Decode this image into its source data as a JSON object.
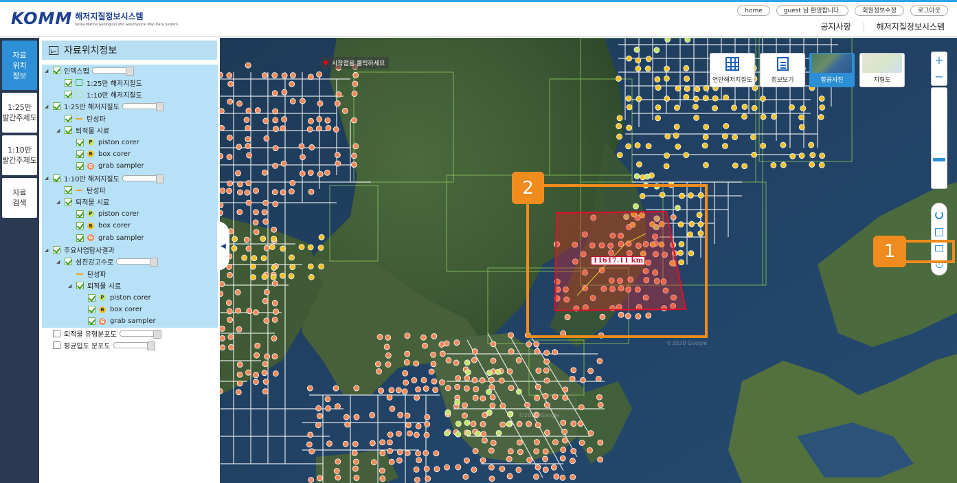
{
  "header": {
    "logo_mark": "KOMM",
    "logo_ko": "해저지질정보시스템",
    "logo_en": "Korea Marine Geological and Geophysical Map Data System",
    "links": [
      "home",
      "guest 님 환영합니다.",
      "회원정보수정",
      "로그아웃"
    ],
    "nav": [
      "공지사항",
      "해저지질정보시스템"
    ]
  },
  "leftnav": [
    {
      "label": "자료\n위치\n정보",
      "active": true
    },
    {
      "label": "1:25만\n발간주제도",
      "active": false
    },
    {
      "label": "1:10만\n발간주제도",
      "active": false
    },
    {
      "label": "자료\n검색",
      "active": false
    }
  ],
  "panel": {
    "title": "자료위치정보",
    "tree": [
      {
        "label": "인덱스맵",
        "indent": 0,
        "arrow": true,
        "checked": true,
        "slider": true,
        "bg": true
      },
      {
        "label": "1:25만 해저지질도",
        "indent": 1,
        "checked": true,
        "sym": "sq-green",
        "bg": true
      },
      {
        "label": "1:10만 해저지질도",
        "indent": 1,
        "checked": true,
        "sym": "sq-light",
        "bg": true
      },
      {
        "label": "1:25만 해저지질도",
        "indent": 0,
        "arrow": true,
        "checked": true,
        "slider": true,
        "bg": true
      },
      {
        "label": "탄성파",
        "indent": 1,
        "checked": true,
        "sym": "line-orange",
        "bg": true
      },
      {
        "label": "퇴적물 시료",
        "indent": 1,
        "arrow": true,
        "checked": true,
        "bg": true
      },
      {
        "label": "piston corer",
        "indent": 2,
        "checked": true,
        "sym": "p",
        "glyph": "P",
        "bg": true
      },
      {
        "label": "box corer",
        "indent": 2,
        "checked": true,
        "sym": "b",
        "glyph": "B",
        "bg": true
      },
      {
        "label": "grab sampler",
        "indent": 2,
        "checked": true,
        "sym": "g",
        "glyph": "G",
        "bg": true
      },
      {
        "label": "1:10만 해저지질도",
        "indent": 0,
        "arrow": true,
        "checked": true,
        "slider": true,
        "bg": true
      },
      {
        "label": "탄성파",
        "indent": 1,
        "checked": true,
        "sym": "line-orange",
        "bg": true
      },
      {
        "label": "퇴적물 시료",
        "indent": 1,
        "arrow": true,
        "checked": true,
        "bg": true
      },
      {
        "label": "piston corer",
        "indent": 2,
        "checked": true,
        "sym": "p",
        "glyph": "P",
        "bg": true
      },
      {
        "label": "box corer",
        "indent": 2,
        "checked": true,
        "sym": "b",
        "glyph": "B",
        "bg": true
      },
      {
        "label": "grab sampler",
        "indent": 2,
        "checked": true,
        "sym": "g",
        "glyph": "G",
        "bg": true
      },
      {
        "label": "주요사업탐사결과",
        "indent": 0,
        "arrow": true,
        "checked": true,
        "bg": true
      },
      {
        "label": "섬진강고수로",
        "indent": 1,
        "arrow": true,
        "checked": true,
        "slider": true,
        "bg": true
      },
      {
        "label": "탄성파",
        "indent": 2,
        "checked": false,
        "sym": "line-orange",
        "bg": true,
        "nochk": true
      },
      {
        "label": "퇴적물 시료",
        "indent": 2,
        "arrow": true,
        "checked": true,
        "bg": true
      },
      {
        "label": "piston corer",
        "indent": 3,
        "checked": true,
        "sym": "p",
        "glyph": "P",
        "bg": true
      },
      {
        "label": "box corer",
        "indent": 3,
        "checked": true,
        "sym": "b",
        "glyph": "B",
        "bg": true
      },
      {
        "label": "grab sampler",
        "indent": 3,
        "checked": true,
        "sym": "g",
        "glyph": "G",
        "bg": true
      },
      {
        "label": "퇴적물 유형분포도",
        "indent": 0,
        "checked": false,
        "slider": true,
        "bg": false
      },
      {
        "label": "평균입도 분포도",
        "indent": 0,
        "checked": false,
        "slider": true,
        "bg": false
      }
    ]
  },
  "map": {
    "hint": "시작점을 클릭하세요",
    "measure_label": "11617.11 km",
    "watermark": "©2020 Google",
    "map_types": [
      {
        "label": "연안해저지질도",
        "icon": "grid-icon",
        "active": false
      },
      {
        "label": "정보보기",
        "icon": "doc-icon",
        "active": false
      },
      {
        "label": "항공사진",
        "icon": "satellite-thumb",
        "active": true
      },
      {
        "label": "지형도",
        "icon": "terrain-thumb",
        "active": false
      }
    ],
    "zoom_in": "+",
    "zoom_out": "−"
  },
  "annotations": {
    "badge1": "1",
    "badge2": "2"
  },
  "colors": {
    "accent": "#2d8fd6",
    "highlight": "#f08c1e",
    "measure": "#e0102a"
  }
}
